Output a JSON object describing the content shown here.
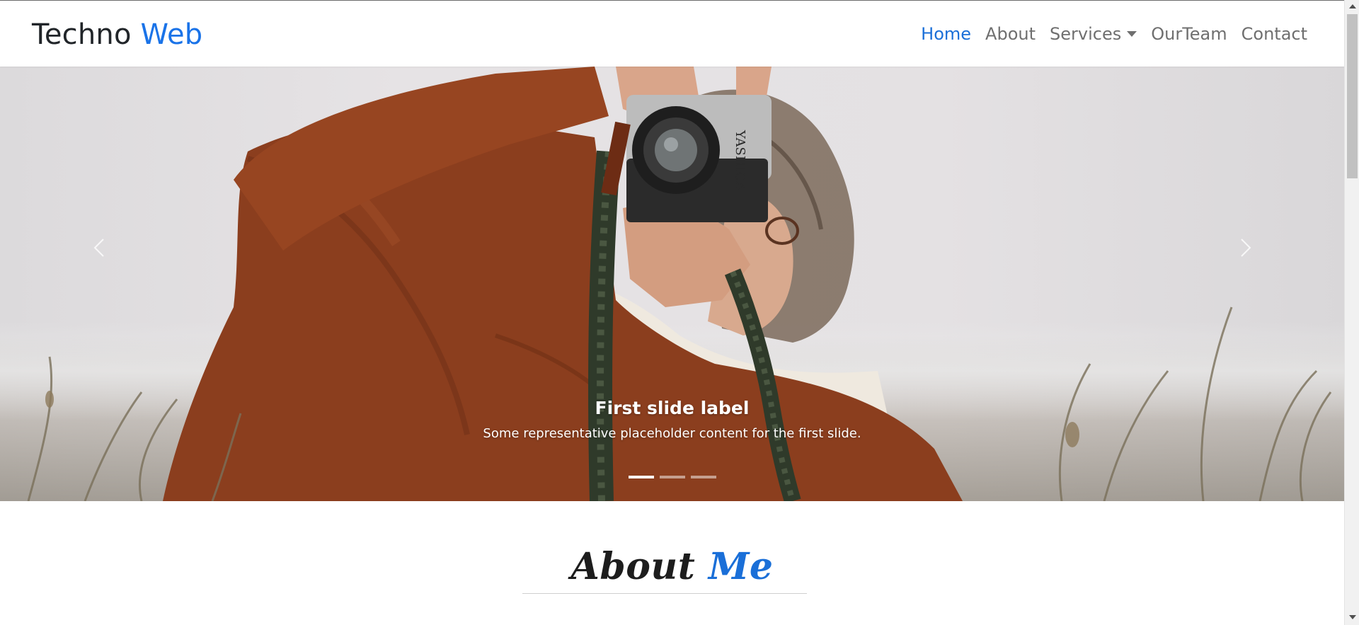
{
  "navbar": {
    "brand_primary": "Techno",
    "brand_accent": "Web",
    "links": [
      {
        "label": "Home",
        "active": true
      },
      {
        "label": "About",
        "active": false
      },
      {
        "label": "Services",
        "active": false,
        "dropdown": true
      },
      {
        "label": "OurTeam",
        "active": false
      },
      {
        "label": "Contact",
        "active": false
      }
    ]
  },
  "carousel": {
    "caption_title": "First slide label",
    "caption_text": "Some representative placeholder content for the first slide.",
    "camera_brand": "YASHICA",
    "indicator_count": 3,
    "active_indicator": 0,
    "prev_icon": "chevron-left-icon",
    "next_icon": "chevron-right-icon"
  },
  "about": {
    "title_primary": "About",
    "title_accent": "Me"
  },
  "colors": {
    "accent": "#1a6fd8",
    "nav_text": "#6f6f6f",
    "brand_text": "#212529"
  }
}
